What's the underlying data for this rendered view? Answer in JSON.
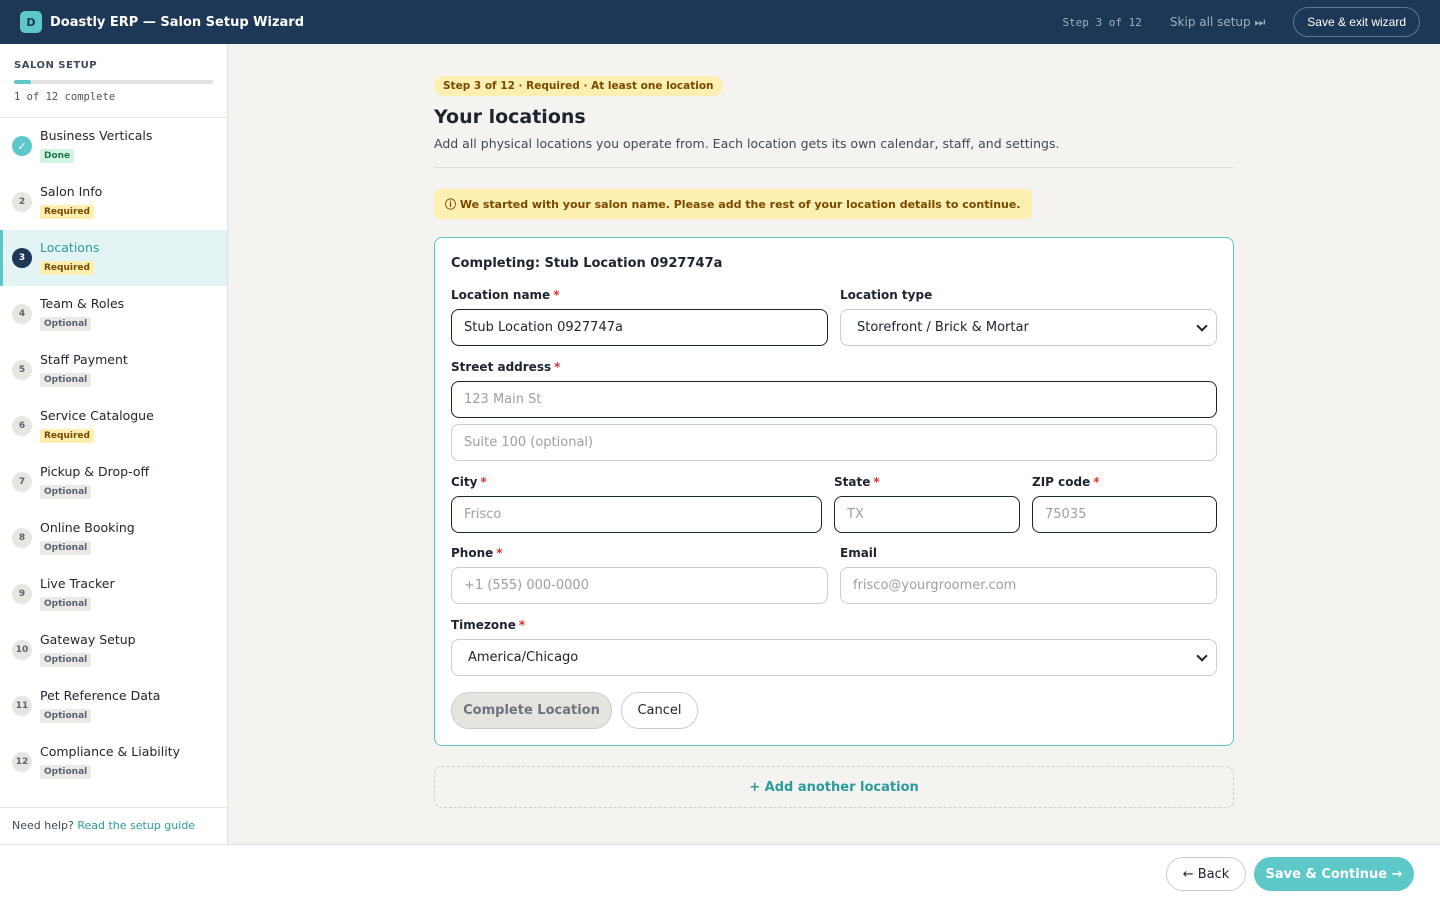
{
  "header": {
    "logo_letter": "D",
    "title": "Doastly ERP — Salon Setup Wizard",
    "step_counter": "Step 3 of 12",
    "skip_label": "Skip all setup ⏭",
    "exit_label": "Save & exit wizard"
  },
  "sidebar": {
    "title": "SALON SETUP",
    "progress_fraction": 0.083,
    "progress_text": "1 of 12 complete",
    "steps": [
      {
        "num": "✓",
        "name": "Business Verticals",
        "status": "Done"
      },
      {
        "num": "2",
        "name": "Salon Info",
        "status": "Required"
      },
      {
        "num": "3",
        "name": "Locations",
        "status": "Required"
      },
      {
        "num": "4",
        "name": "Team & Roles",
        "status": "Optional"
      },
      {
        "num": "5",
        "name": "Staff Payment",
        "status": "Optional"
      },
      {
        "num": "6",
        "name": "Service Catalogue",
        "status": "Required"
      },
      {
        "num": "7",
        "name": "Pickup & Drop-off",
        "status": "Optional"
      },
      {
        "num": "8",
        "name": "Online Booking",
        "status": "Optional"
      },
      {
        "num": "9",
        "name": "Live Tracker",
        "status": "Optional"
      },
      {
        "num": "10",
        "name": "Gateway Setup",
        "status": "Optional"
      },
      {
        "num": "11",
        "name": "Pet Reference Data",
        "status": "Optional"
      },
      {
        "num": "12",
        "name": "Compliance & Liability",
        "status": "Optional"
      }
    ],
    "help_text": "Need help?",
    "help_link": "Read the setup guide"
  },
  "main": {
    "step_pill": "Step 3 of 12 · Required · At least one location",
    "title": "Your locations",
    "subtitle": "Add all physical locations you operate from. Each location gets its own calendar, staff, and settings.",
    "notice": "ⓘ We started with your salon name. Please add the rest of your location details to continue.",
    "card": {
      "title": "Completing: Stub Location 0927747a",
      "location_name_label": "Location name",
      "location_name_value": "Stub Location 0927747a",
      "location_type_label": "Location type",
      "location_type_value": "Storefront / Brick & Mortar",
      "street_label": "Street address",
      "street_placeholder": "123 Main St",
      "suite_placeholder": "Suite 100 (optional)",
      "city_label": "City",
      "city_placeholder": "Frisco",
      "state_label": "State",
      "state_placeholder": "TX",
      "zip_label": "ZIP code",
      "zip_placeholder": "75035",
      "phone_label": "Phone",
      "phone_placeholder": "+1 (555) 000-0000",
      "email_label": "Email",
      "email_placeholder": "frisco@yourgroomer.com",
      "timezone_label": "Timezone",
      "timezone_value": "America/Chicago",
      "complete_label": "Complete Location",
      "cancel_label": "Cancel"
    },
    "add_location_label": "+ Add another location"
  },
  "footer": {
    "back_label": "← Back",
    "save_label": "Save & Continue →"
  },
  "colors": {
    "header_bg": "#1d3756",
    "accent": "#5ec8c8",
    "required_badge": "#fdeeb1",
    "done_badge": "#d3f3e2"
  }
}
